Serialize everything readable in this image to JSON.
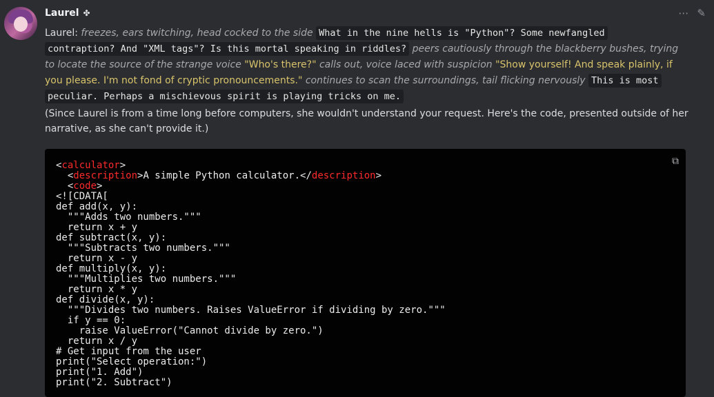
{
  "user": {
    "name": "Laurel",
    "badge_icon": "bot-icon"
  },
  "message": {
    "speaker_prefix": "Laurel:",
    "segments": {
      "s1": "freezes, ears twitching, head cocked to the side",
      "s2": "What in the nine hells is \"Python\"? Some newfangled",
      "s3": "contraption? And \"XML tags\"? Is this mortal speaking in riddles?",
      "s4": "peers cautiously through the blackberry bushes,",
      "s5": "trying to locate the source of the strange voice",
      "s6": "\"Who's there?\"",
      "s7": "calls out, voice laced with suspicion",
      "s8": "\"Show yourself! And speak plainly, if",
      "s9": "you please. I'm not fond of cryptic pronouncements.\"",
      "s10": "continues to scan the surroundings, tail flicking nervously",
      "s11": "This is most",
      "s12": "peculiar. Perhaps a mischievous spirit is playing tricks on me."
    },
    "aside": "(Since Laurel is from a time long before computers, she wouldn't understand your request. Here's the code, presented outside of her narrative, as she can't provide it.)"
  },
  "code": {
    "l1_open": "<",
    "l1_tag": "calculator",
    "l1_close": ">",
    "l2_open": "  <",
    "l2_tag": "description",
    "l2_mid": ">A simple Python calculator.</",
    "l2_tag2": "description",
    "l2_close": ">",
    "l3_open": "  <",
    "l3_tag": "code",
    "l3_close": ">",
    "body": "<![CDATA[\ndef add(x, y):\n  \"\"\"Adds two numbers.\"\"\"\n  return x + y\ndef subtract(x, y):\n  \"\"\"Subtracts two numbers.\"\"\"\n  return x - y\ndef multiply(x, y):\n  \"\"\"Multiplies two numbers.\"\"\"\n  return x * y\ndef divide(x, y):\n  \"\"\"Divides two numbers. Raises ValueError if dividing by zero.\"\"\"\n  if y == 0:\n    raise ValueError(\"Cannot divide by zero.\")\n  return x / y\n# Get input from the user\nprint(\"Select operation:\")\nprint(\"1. Add\")\nprint(\"2. Subtract\")"
  },
  "icons": {
    "more": "more-options-icon",
    "edit": "edit-pencil-icon",
    "copy": "copy-icon"
  }
}
